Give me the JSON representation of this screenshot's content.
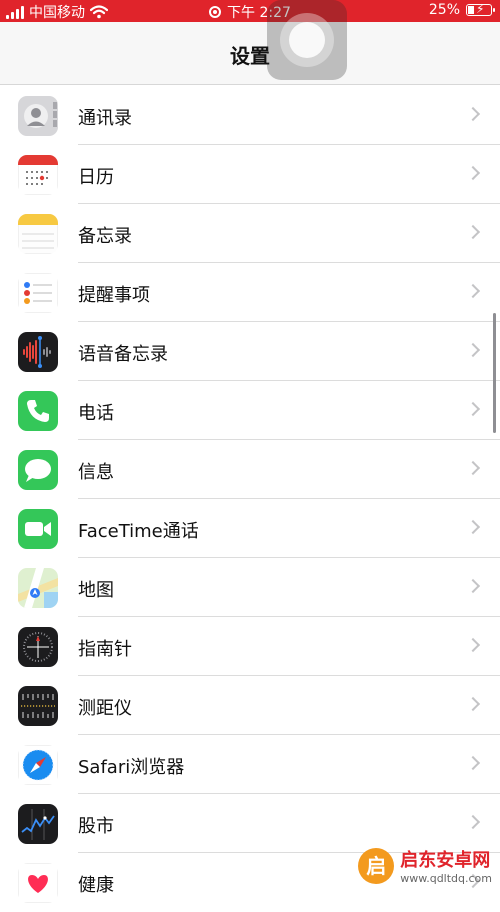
{
  "status_bar": {
    "carrier": "中国移动",
    "time": "下午 2:27",
    "battery": "25%",
    "battery_level": 0.25
  },
  "header": {
    "title": "设置"
  },
  "settings_items": [
    {
      "label": "通讯录",
      "icon": "contacts-icon"
    },
    {
      "label": "日历",
      "icon": "calendar-icon"
    },
    {
      "label": "备忘录",
      "icon": "notes-icon"
    },
    {
      "label": "提醒事项",
      "icon": "reminders-icon"
    },
    {
      "label": "语音备忘录",
      "icon": "voice-memos-icon"
    },
    {
      "label": "电话",
      "icon": "phone-icon"
    },
    {
      "label": "信息",
      "icon": "messages-icon"
    },
    {
      "label": "FaceTime通话",
      "icon": "facetime-icon"
    },
    {
      "label": "地图",
      "icon": "maps-icon"
    },
    {
      "label": "指南针",
      "icon": "compass-icon"
    },
    {
      "label": "测距仪",
      "icon": "measure-icon"
    },
    {
      "label": "Safari浏览器",
      "icon": "safari-icon"
    },
    {
      "label": "股市",
      "icon": "stocks-icon"
    },
    {
      "label": "健康",
      "icon": "health-icon"
    }
  ],
  "watermark": {
    "logo_char": "启",
    "title": "启东安卓网",
    "url": "www.qdltdq.com"
  },
  "colors": {
    "status_bar": "#e0242b",
    "chevron": "#c4c4c6"
  }
}
